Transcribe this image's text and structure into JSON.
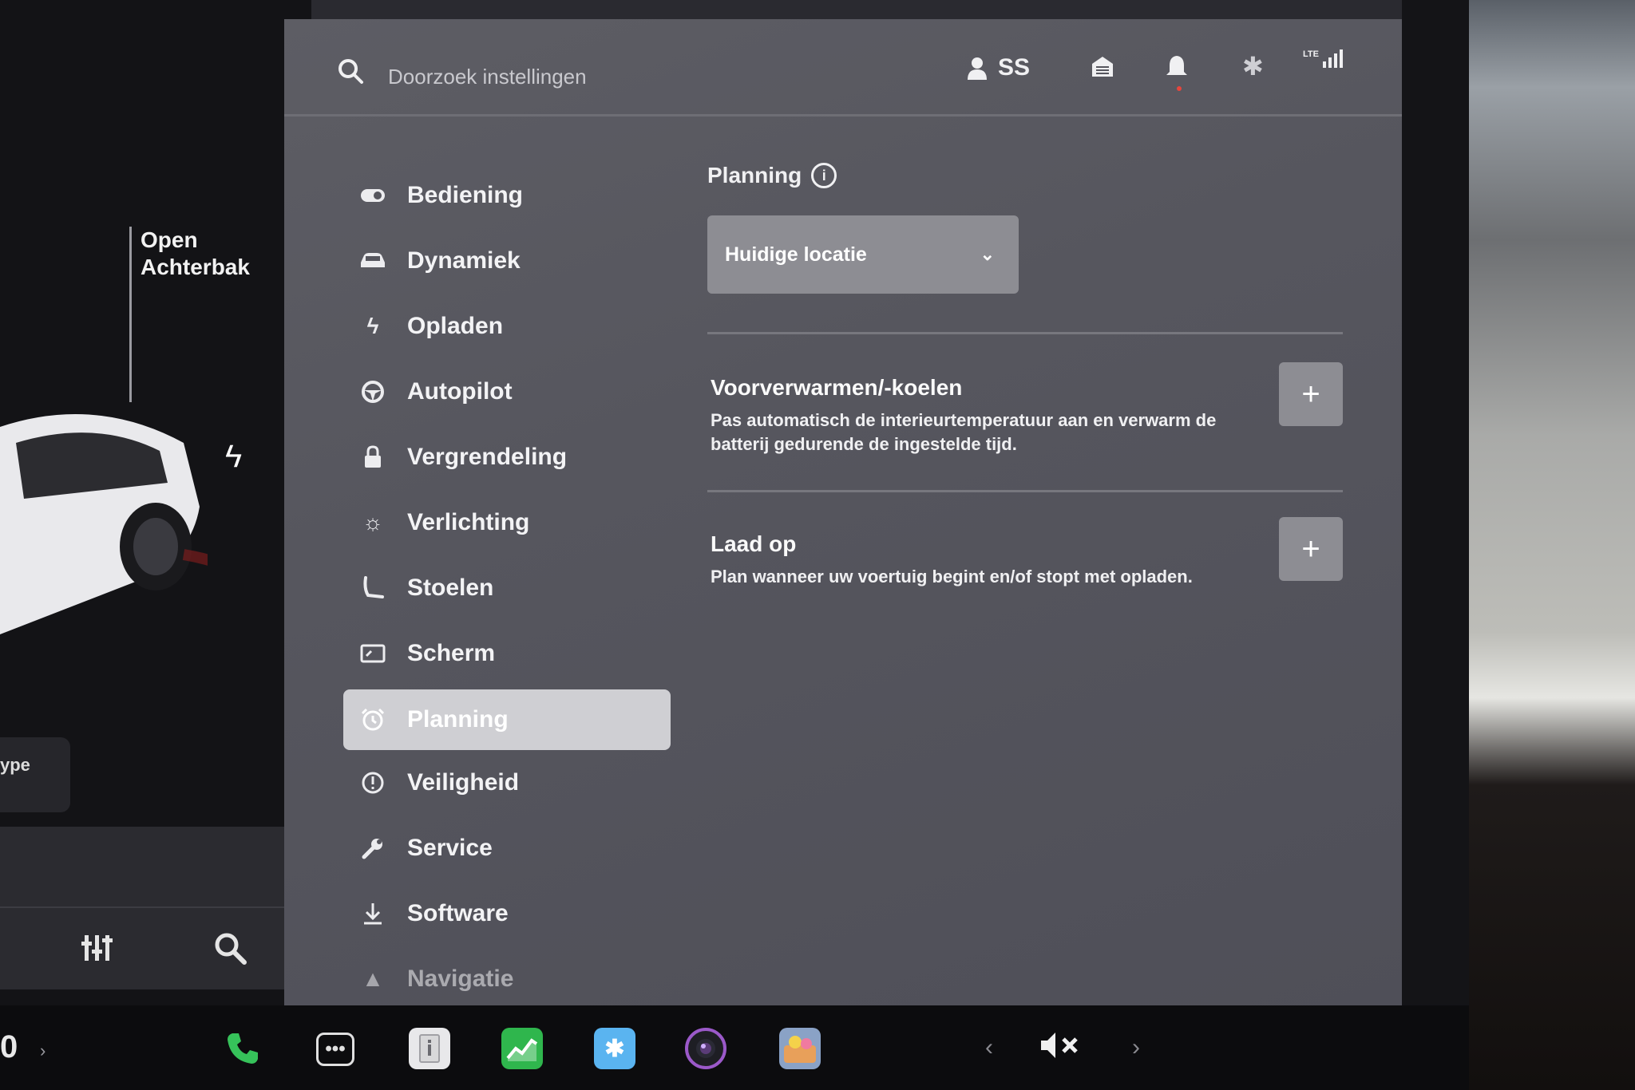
{
  "car_panel": {
    "trunk_line1": "Open",
    "trunk_line2": "Achterbak",
    "type_chip": "ype"
  },
  "topbar": {
    "search_placeholder": "Doorzoek instellingen",
    "profile_name": "SS",
    "signal_label": "LTE"
  },
  "nav": {
    "items": [
      {
        "label": "Bediening",
        "icon": "toggle-icon"
      },
      {
        "label": "Dynamiek",
        "icon": "car-icon"
      },
      {
        "label": "Opladen",
        "icon": "bolt-icon"
      },
      {
        "label": "Autopilot",
        "icon": "steering-wheel-icon"
      },
      {
        "label": "Vergrendeling",
        "icon": "lock-icon"
      },
      {
        "label": "Verlichting",
        "icon": "sun-icon"
      },
      {
        "label": "Stoelen",
        "icon": "seat-icon"
      },
      {
        "label": "Scherm",
        "icon": "display-icon"
      },
      {
        "label": "Planning",
        "icon": "alarm-clock-icon",
        "active": true
      },
      {
        "label": "Veiligheid",
        "icon": "alert-circle-icon"
      },
      {
        "label": "Service",
        "icon": "wrench-icon"
      },
      {
        "label": "Software",
        "icon": "download-icon"
      },
      {
        "label": "Navigatie",
        "icon": "navigation-arrow-icon"
      }
    ]
  },
  "content": {
    "section_title": "Planning",
    "location_select": "Huidige locatie",
    "precondition": {
      "title": "Voorverwarmen/-koelen",
      "description": "Pas automatisch de interieurtemperatuur aan en verwarm de batterij gedurende de ingestelde tijd."
    },
    "charge": {
      "title": "Laad op",
      "description": "Plan wanneer uw voertuig begint en/of stopt met opladen."
    },
    "add_label": "+"
  },
  "dock": {
    "temp_fragment": "0"
  },
  "colors": {
    "panel_bg": "#56565e",
    "active_nav": "#cfcfd3",
    "button_bg": "#8d8d93",
    "phone_green": "#36c25a"
  }
}
